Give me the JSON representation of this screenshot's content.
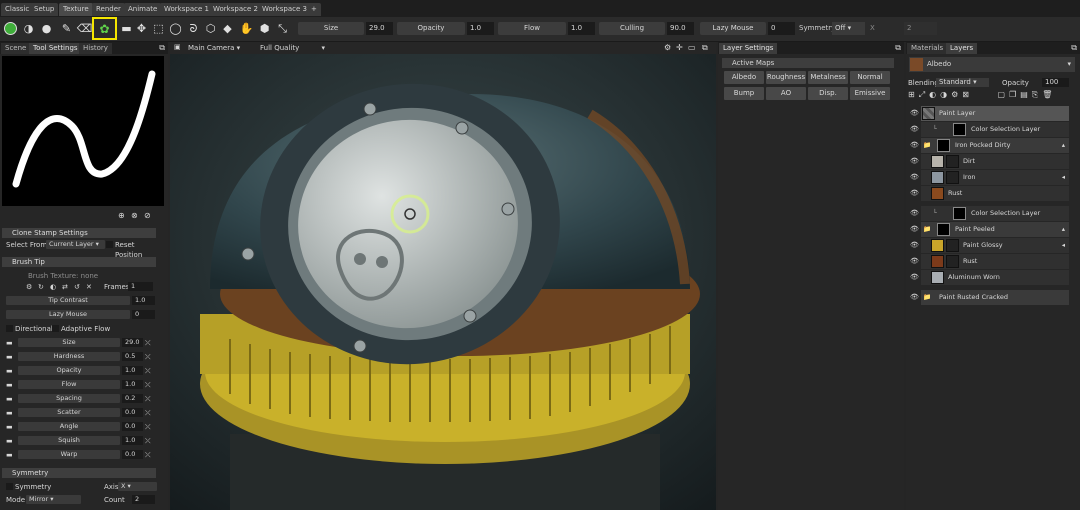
{
  "menu_tabs": [
    "Classic",
    "Setup",
    "Texture",
    "Render",
    "Animate",
    "Workspace 1",
    "Workspace 2",
    "Workspace 3",
    "+"
  ],
  "toolbar": {
    "size_label": "Size",
    "size_value": "29.0",
    "opacity_label": "Opacity",
    "opacity_value": "1.0",
    "flow_label": "Flow",
    "flow_value": "1.0",
    "culling_label": "Culling",
    "culling_value": "90.0",
    "lazy_label": "Lazy Mouse",
    "lazy_value": "0",
    "symmetry_label": "Symmetry",
    "symmetry_value": "Off",
    "axis_label": "X",
    "count_value": "2"
  },
  "left_tabs": [
    "Scene",
    "Tool Settings",
    "History"
  ],
  "clone": {
    "header": "Clone Stamp Settings",
    "select_from_label": "Select From:",
    "select_from_value": "Current Layer",
    "reset_label": "Reset Position"
  },
  "brush_tip": {
    "header": "Brush Tip",
    "texture_label": "Brush Texture: none",
    "frames_label": "Frames",
    "frames_value": "1",
    "tip_contrast_label": "Tip Contrast",
    "tip_contrast_value": "1.0",
    "lazy_label": "Lazy Mouse",
    "lazy_value": "0",
    "directional_label": "Directional",
    "adaptive_label": "Adaptive Flow",
    "params": [
      {
        "label": "Size",
        "value": "29.0"
      },
      {
        "label": "Hardness",
        "value": "0.5"
      },
      {
        "label": "Opacity",
        "value": "1.0"
      },
      {
        "label": "Flow",
        "value": "1.0"
      },
      {
        "label": "Spacing",
        "value": "0.2"
      },
      {
        "label": "Scatter",
        "value": "0.0"
      },
      {
        "label": "Angle",
        "value": "0.0"
      },
      {
        "label": "Squish",
        "value": "1.0"
      },
      {
        "label": "Warp",
        "value": "0.0"
      }
    ]
  },
  "symmetry": {
    "header": "Symmetry",
    "symmetry_label": "Symmetry",
    "axis_label": "Axis",
    "axis_value": "X",
    "mode_label": "Mode",
    "mode_value": "Mirror",
    "count_label": "Count",
    "count_value": "2"
  },
  "viewport": {
    "camera": "Main Camera",
    "quality": "Full Quality"
  },
  "layer_settings": {
    "tab": "Layer Settings",
    "active_maps_header": "Active Maps",
    "maps": [
      "Albedo",
      "Roughness",
      "Metalness",
      "Normal",
      "Bump",
      "AO",
      "Disp.",
      "Emissive"
    ]
  },
  "layers_panel": {
    "tabs": [
      "Materials",
      "Layers"
    ],
    "channel": "Albedo",
    "blending_label": "Blending",
    "blending_value": "Standard",
    "opacity_label": "Opacity",
    "opacity_value": "100",
    "layers": [
      {
        "name": "Paint Layer"
      },
      {
        "name": "Color Selection Layer"
      },
      {
        "name": "Iron Pocked Dirty"
      },
      {
        "name": "Dirt"
      },
      {
        "name": "Iron"
      },
      {
        "name": "Rust"
      },
      {
        "name": "Color Selection Layer"
      },
      {
        "name": "Paint Peeled"
      },
      {
        "name": "Paint Glossy"
      },
      {
        "name": "Rust"
      },
      {
        "name": "Aluminum Worn"
      },
      {
        "name": "Paint Rusted Cracked"
      }
    ]
  },
  "colors": {
    "highlight": "#f5e600",
    "rust": "#8a4a1e",
    "yellow_paint": "#c9b12a"
  }
}
